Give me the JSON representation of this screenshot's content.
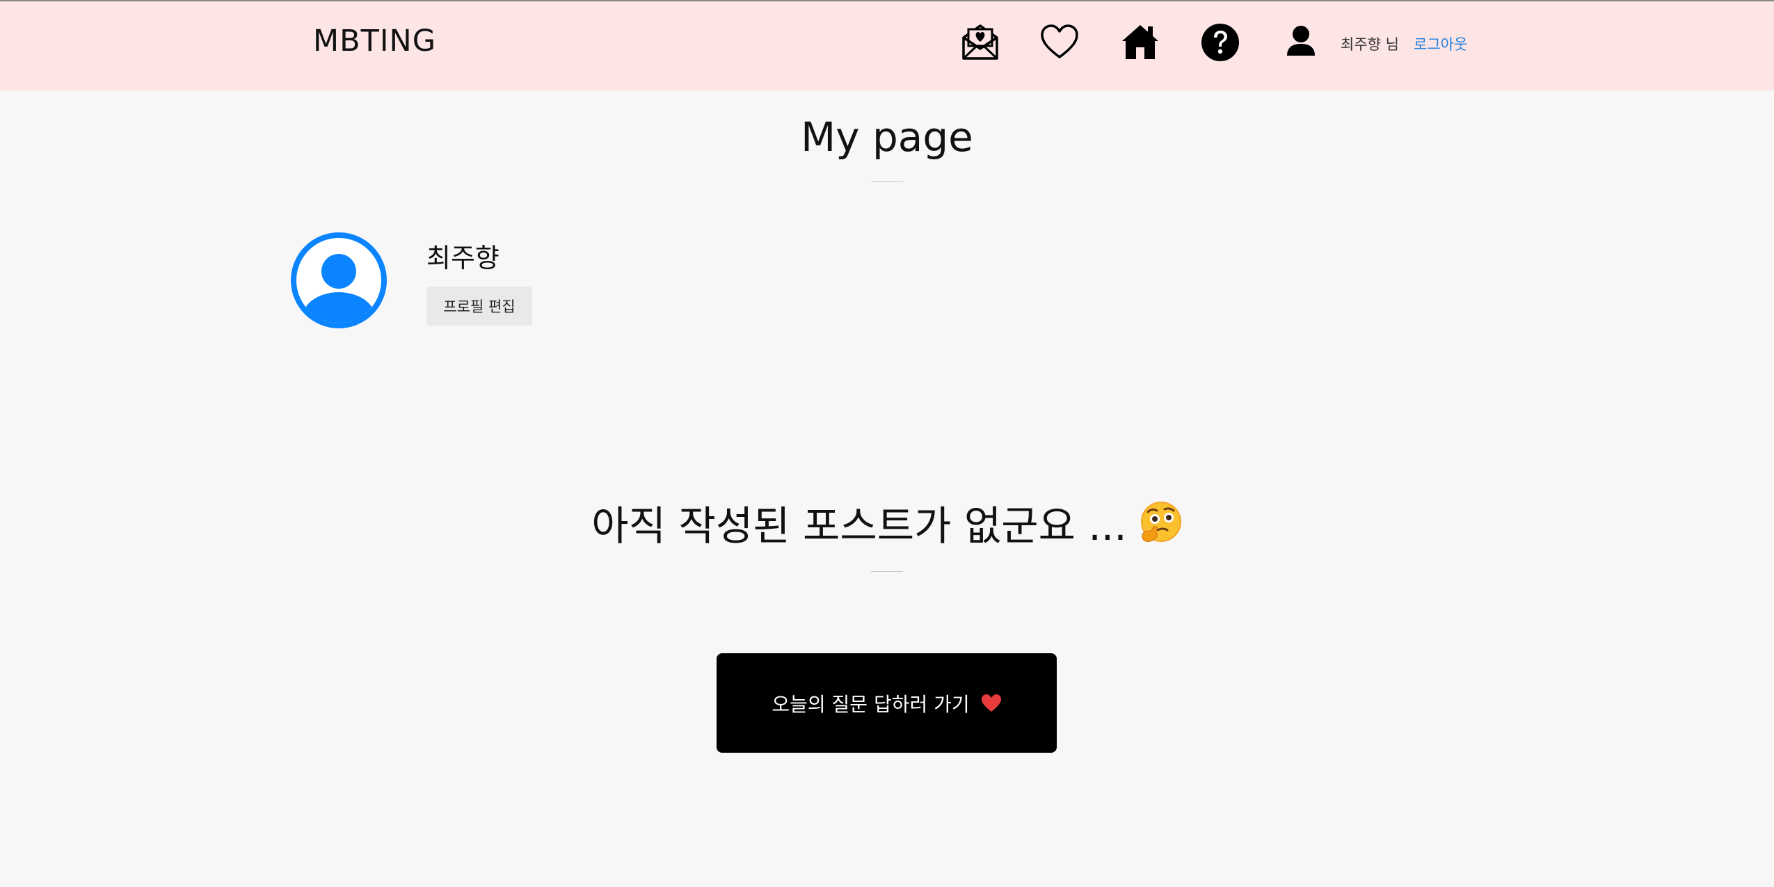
{
  "header": {
    "brand": "MBTING",
    "icons": [
      "envelope-heart-icon",
      "heart-icon",
      "home-icon",
      "question-icon",
      "user-icon"
    ],
    "user_greeting": "최주향 님",
    "logout_label": "로그아웃",
    "background_color": "#fde5e6",
    "link_color": "#1f7fdc"
  },
  "main": {
    "title": "My page",
    "profile": {
      "name": "최주향",
      "avatar_icon": "user-circle-icon",
      "avatar_color": "#0a84ff",
      "edit_button_label": "프로필 편집"
    },
    "empty_message": "아직 작성된 포스트가 없군요 ...",
    "empty_emoji": "thinking-face-icon",
    "cta_label": "오늘의 질문 답하러 가기",
    "cta_icon": "red-heart-icon",
    "accent_color": "#e83b3b"
  }
}
